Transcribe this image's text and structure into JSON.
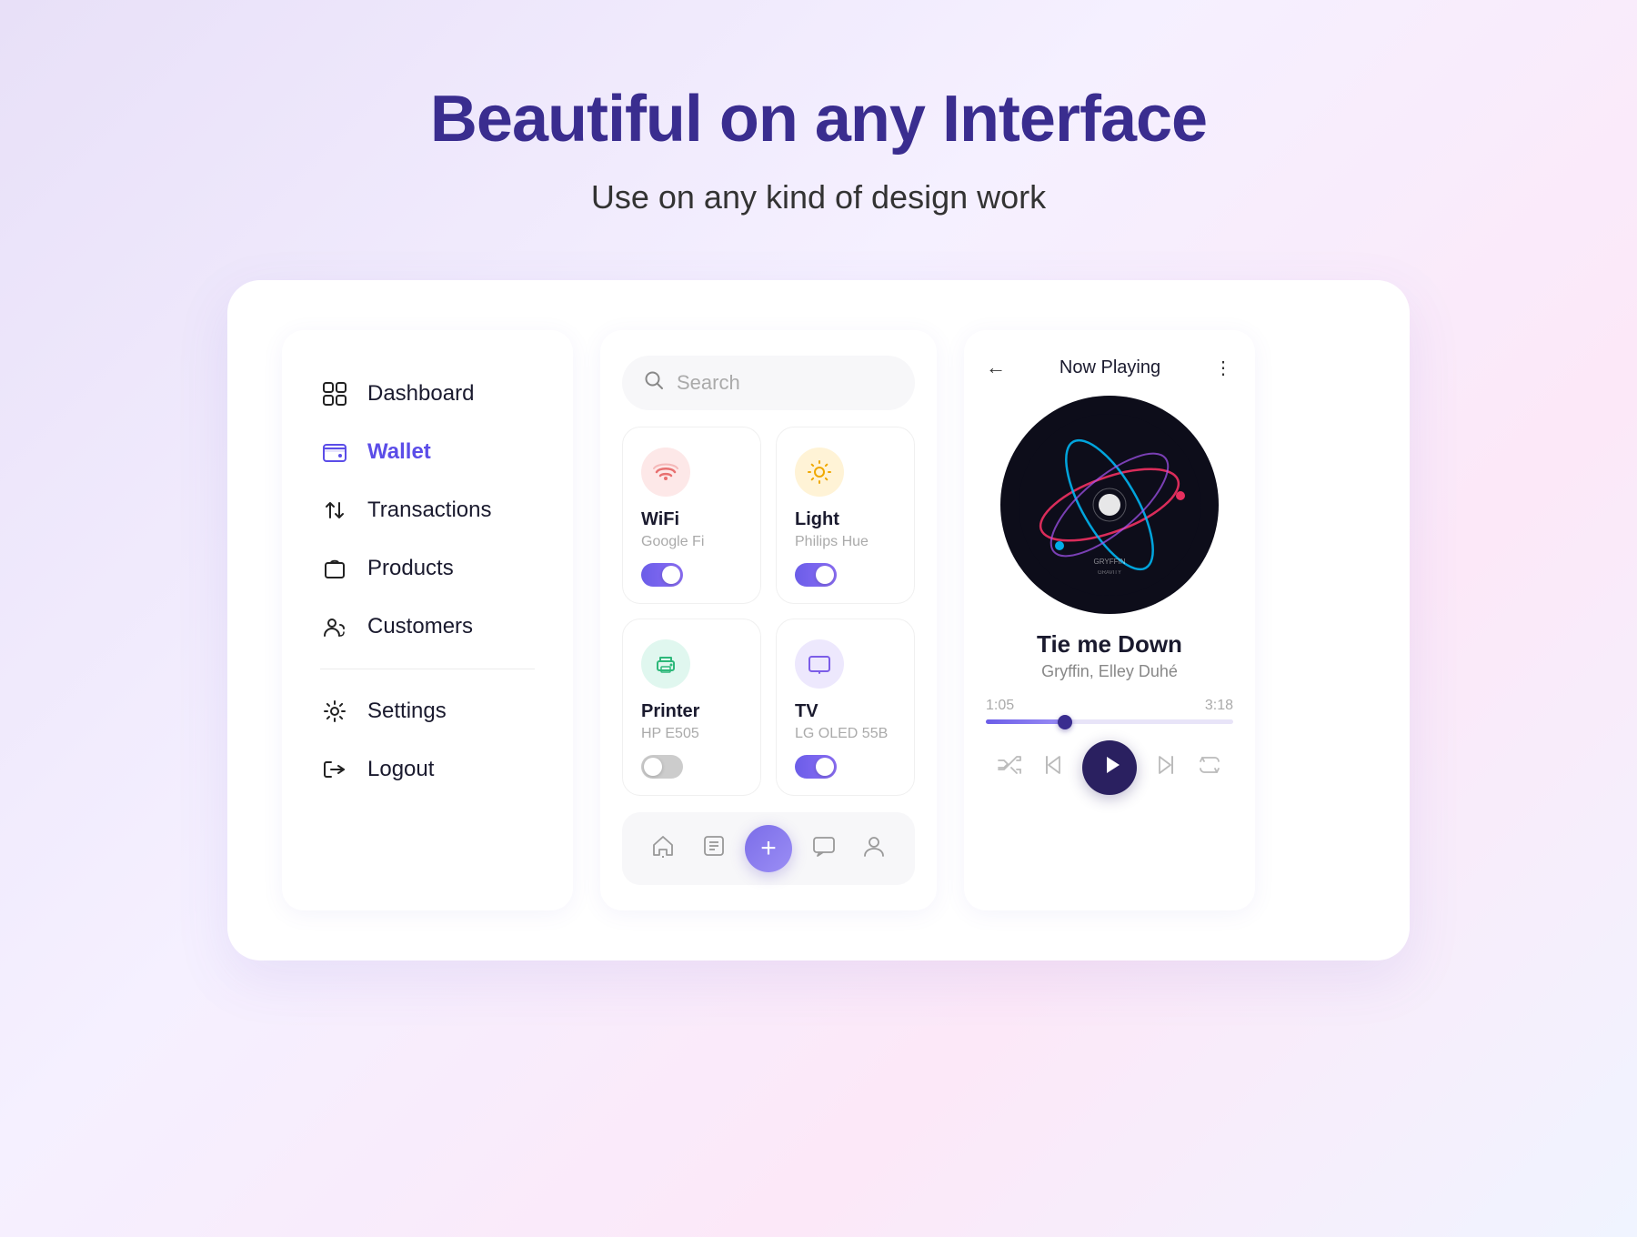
{
  "hero": {
    "title": "Beautiful on any Interface",
    "subtitle": "Use on any kind of design work"
  },
  "nav": {
    "items": [
      {
        "id": "dashboard",
        "label": "Dashboard",
        "icon": "⊞",
        "active": false
      },
      {
        "id": "wallet",
        "label": "Wallet",
        "icon": "🗂",
        "active": true
      },
      {
        "id": "transactions",
        "label": "Transactions",
        "icon": "↕",
        "active": false
      },
      {
        "id": "products",
        "label": "Products",
        "icon": "🛍",
        "active": false
      },
      {
        "id": "customers",
        "label": "Customers",
        "icon": "👤",
        "active": false
      },
      {
        "id": "settings",
        "label": "Settings",
        "icon": "⚙",
        "active": false
      },
      {
        "id": "logout",
        "label": "Logout",
        "icon": "⬚",
        "active": false
      }
    ]
  },
  "smart": {
    "search_placeholder": "Search",
    "devices": [
      {
        "id": "wifi",
        "name": "WiFi",
        "sub": "Google Fi",
        "icon": "wifi",
        "on": true
      },
      {
        "id": "light",
        "name": "Light",
        "sub": "Philips Hue",
        "icon": "light",
        "on": true
      },
      {
        "id": "printer",
        "name": "Printer",
        "sub": "HP E505",
        "icon": "printer",
        "on": false
      },
      {
        "id": "tv",
        "name": "TV",
        "sub": "LG OLED 55B",
        "icon": "tv",
        "on": true
      }
    ]
  },
  "player": {
    "header_title": "Now Playing",
    "track_name": "Tie me Down",
    "track_artist": "Gryffin, Elley Duhé",
    "time_current": "1:05",
    "time_total": "3:18",
    "progress_percent": 32
  }
}
